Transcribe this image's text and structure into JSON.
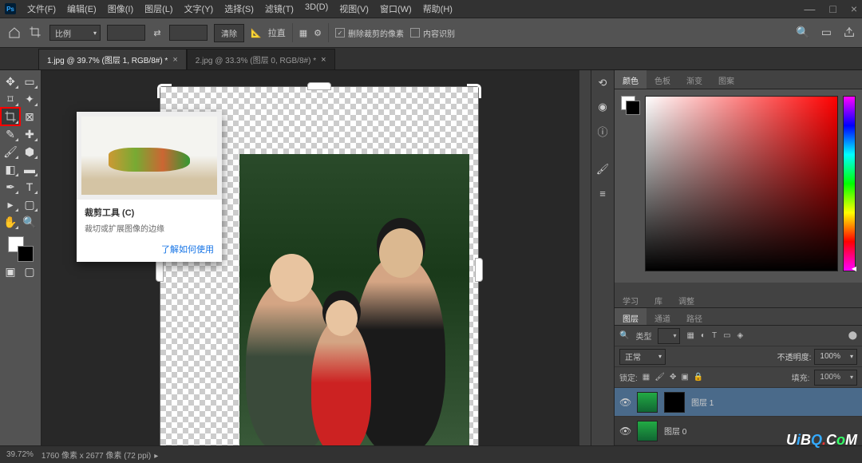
{
  "menu": {
    "file": "文件(F)",
    "edit": "编辑(E)",
    "image": "图像(I)",
    "layer": "图层(L)",
    "type": "文字(Y)",
    "select": "选择(S)",
    "filter": "滤镜(T)",
    "3d": "3D(D)",
    "view": "视图(V)",
    "window": "窗口(W)",
    "help": "帮助(H)"
  },
  "winctl": {
    "min": "—",
    "max": "□",
    "close": "×"
  },
  "optbar": {
    "ratio": "比例",
    "clear": "清除",
    "straighten": "拉直",
    "delete_cropped": "删除裁剪的像素",
    "content_aware": "内容识别"
  },
  "tabs": [
    {
      "label": "1.jpg @ 39.7% (图层 1, RGB/8#) *",
      "active": true
    },
    {
      "label": "2.jpg @ 33.3% (图层 0, RGB/8#) *",
      "active": false
    }
  ],
  "tooltip": {
    "title": "裁剪工具 (C)",
    "desc": "裁切或扩展图像的边缘",
    "link": "了解如何使用"
  },
  "panel_tabs": {
    "color": "颜色",
    "swatches": "色板",
    "gradients": "渐变",
    "patterns": "图案"
  },
  "mid_tabs": {
    "learn": "学习",
    "libraries": "库",
    "adjustments": "调整"
  },
  "layer_tabs": {
    "layers": "图层",
    "channels": "通道",
    "paths": "路径"
  },
  "layers": {
    "kind": "类型",
    "blend": "正常",
    "opacity_label": "不透明度:",
    "opacity": "100%",
    "lock_label": "锁定:",
    "fill_label": "填充:",
    "fill": "100%",
    "items": [
      {
        "name": "图层 1"
      },
      {
        "name": "图层 0"
      }
    ]
  },
  "status": {
    "zoom": "39.72%",
    "dims": "1760 像素 x 2677 像素 (72 ppi)"
  },
  "search_placeholder": "",
  "watermark": {
    "u": "U",
    "i": "i",
    "b": "B",
    "q": "Q",
    "dot": ".",
    "c": "C",
    "o": "o",
    "m": "M"
  }
}
